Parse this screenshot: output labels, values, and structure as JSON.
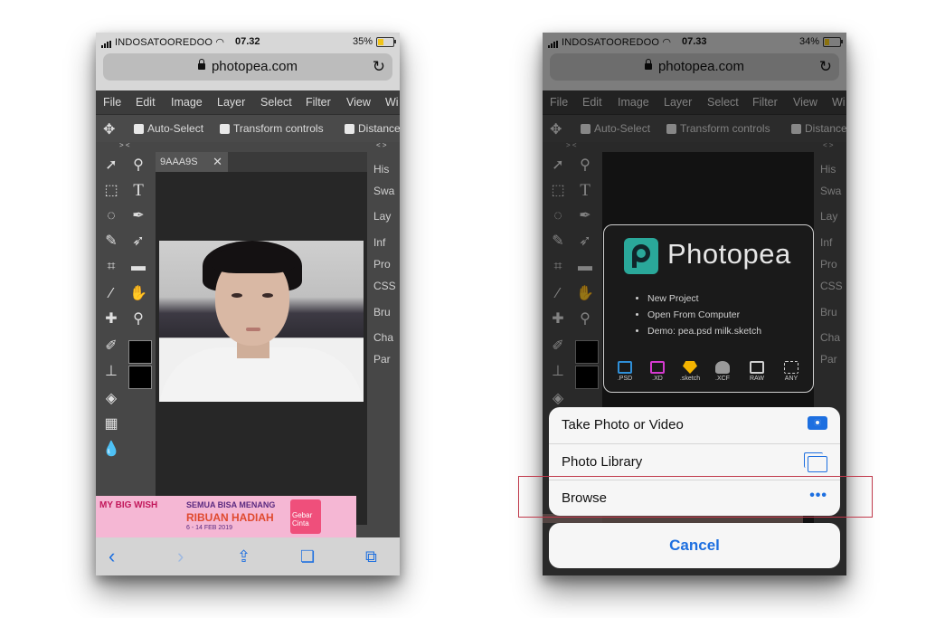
{
  "left": {
    "status": {
      "carrier": "INDOSATOOREDOO",
      "time": "07.32",
      "battery": "35%",
      "battery_level": 0.35
    },
    "url": "photopea.com",
    "tab_title": "9AAA9S",
    "ad": {
      "brand": "MY BIG WISH",
      "line1": "SEMUA BISA MENANG",
      "line2": "RIBUAN HADIAH",
      "line3": "6 - 14 FEB 2019",
      "gift_label": "Gebar Cinta"
    }
  },
  "right": {
    "status": {
      "carrier": "INDOSATOOREDOO",
      "time": "07.33",
      "battery": "34%",
      "battery_level": 0.34
    },
    "url": "photopea.com",
    "startup": {
      "app_name": "Photopea",
      "links": [
        "New Project",
        "Open From Computer",
        "Demo:  pea.psd  milk.sketch"
      ],
      "formats": [
        {
          "label": ".PSD",
          "color": "#2f8fd8"
        },
        {
          "label": ".XD",
          "color": "#d63ad0"
        },
        {
          "label": ".sketch",
          "color": "#f4b400"
        },
        {
          "label": ".XCF",
          "color": "#9a9a9a"
        },
        {
          "label": "RAW",
          "color": "#d0d0d0"
        },
        {
          "label": "ANY",
          "color": "#d0d0d0"
        }
      ]
    },
    "sheet": {
      "take_photo": "Take Photo or Video",
      "photo_library": "Photo Library",
      "browse": "Browse",
      "cancel": "Cancel"
    }
  },
  "menu": [
    "File",
    "Edit",
    "Image",
    "Layer",
    "Select",
    "Filter",
    "View",
    "Wi"
  ],
  "options": {
    "auto_select": "Auto-Select",
    "transform": "Transform controls",
    "distance": "Distance"
  },
  "panels": [
    "His",
    "Swa",
    "Lay",
    "Inf",
    "Pro",
    "CSS",
    "Bru",
    "Cha",
    "Par"
  ],
  "collapse_left": "> <",
  "collapse_right": "< >",
  "accent_color": "#1d6fe0",
  "highlight_color": "#c0394b"
}
